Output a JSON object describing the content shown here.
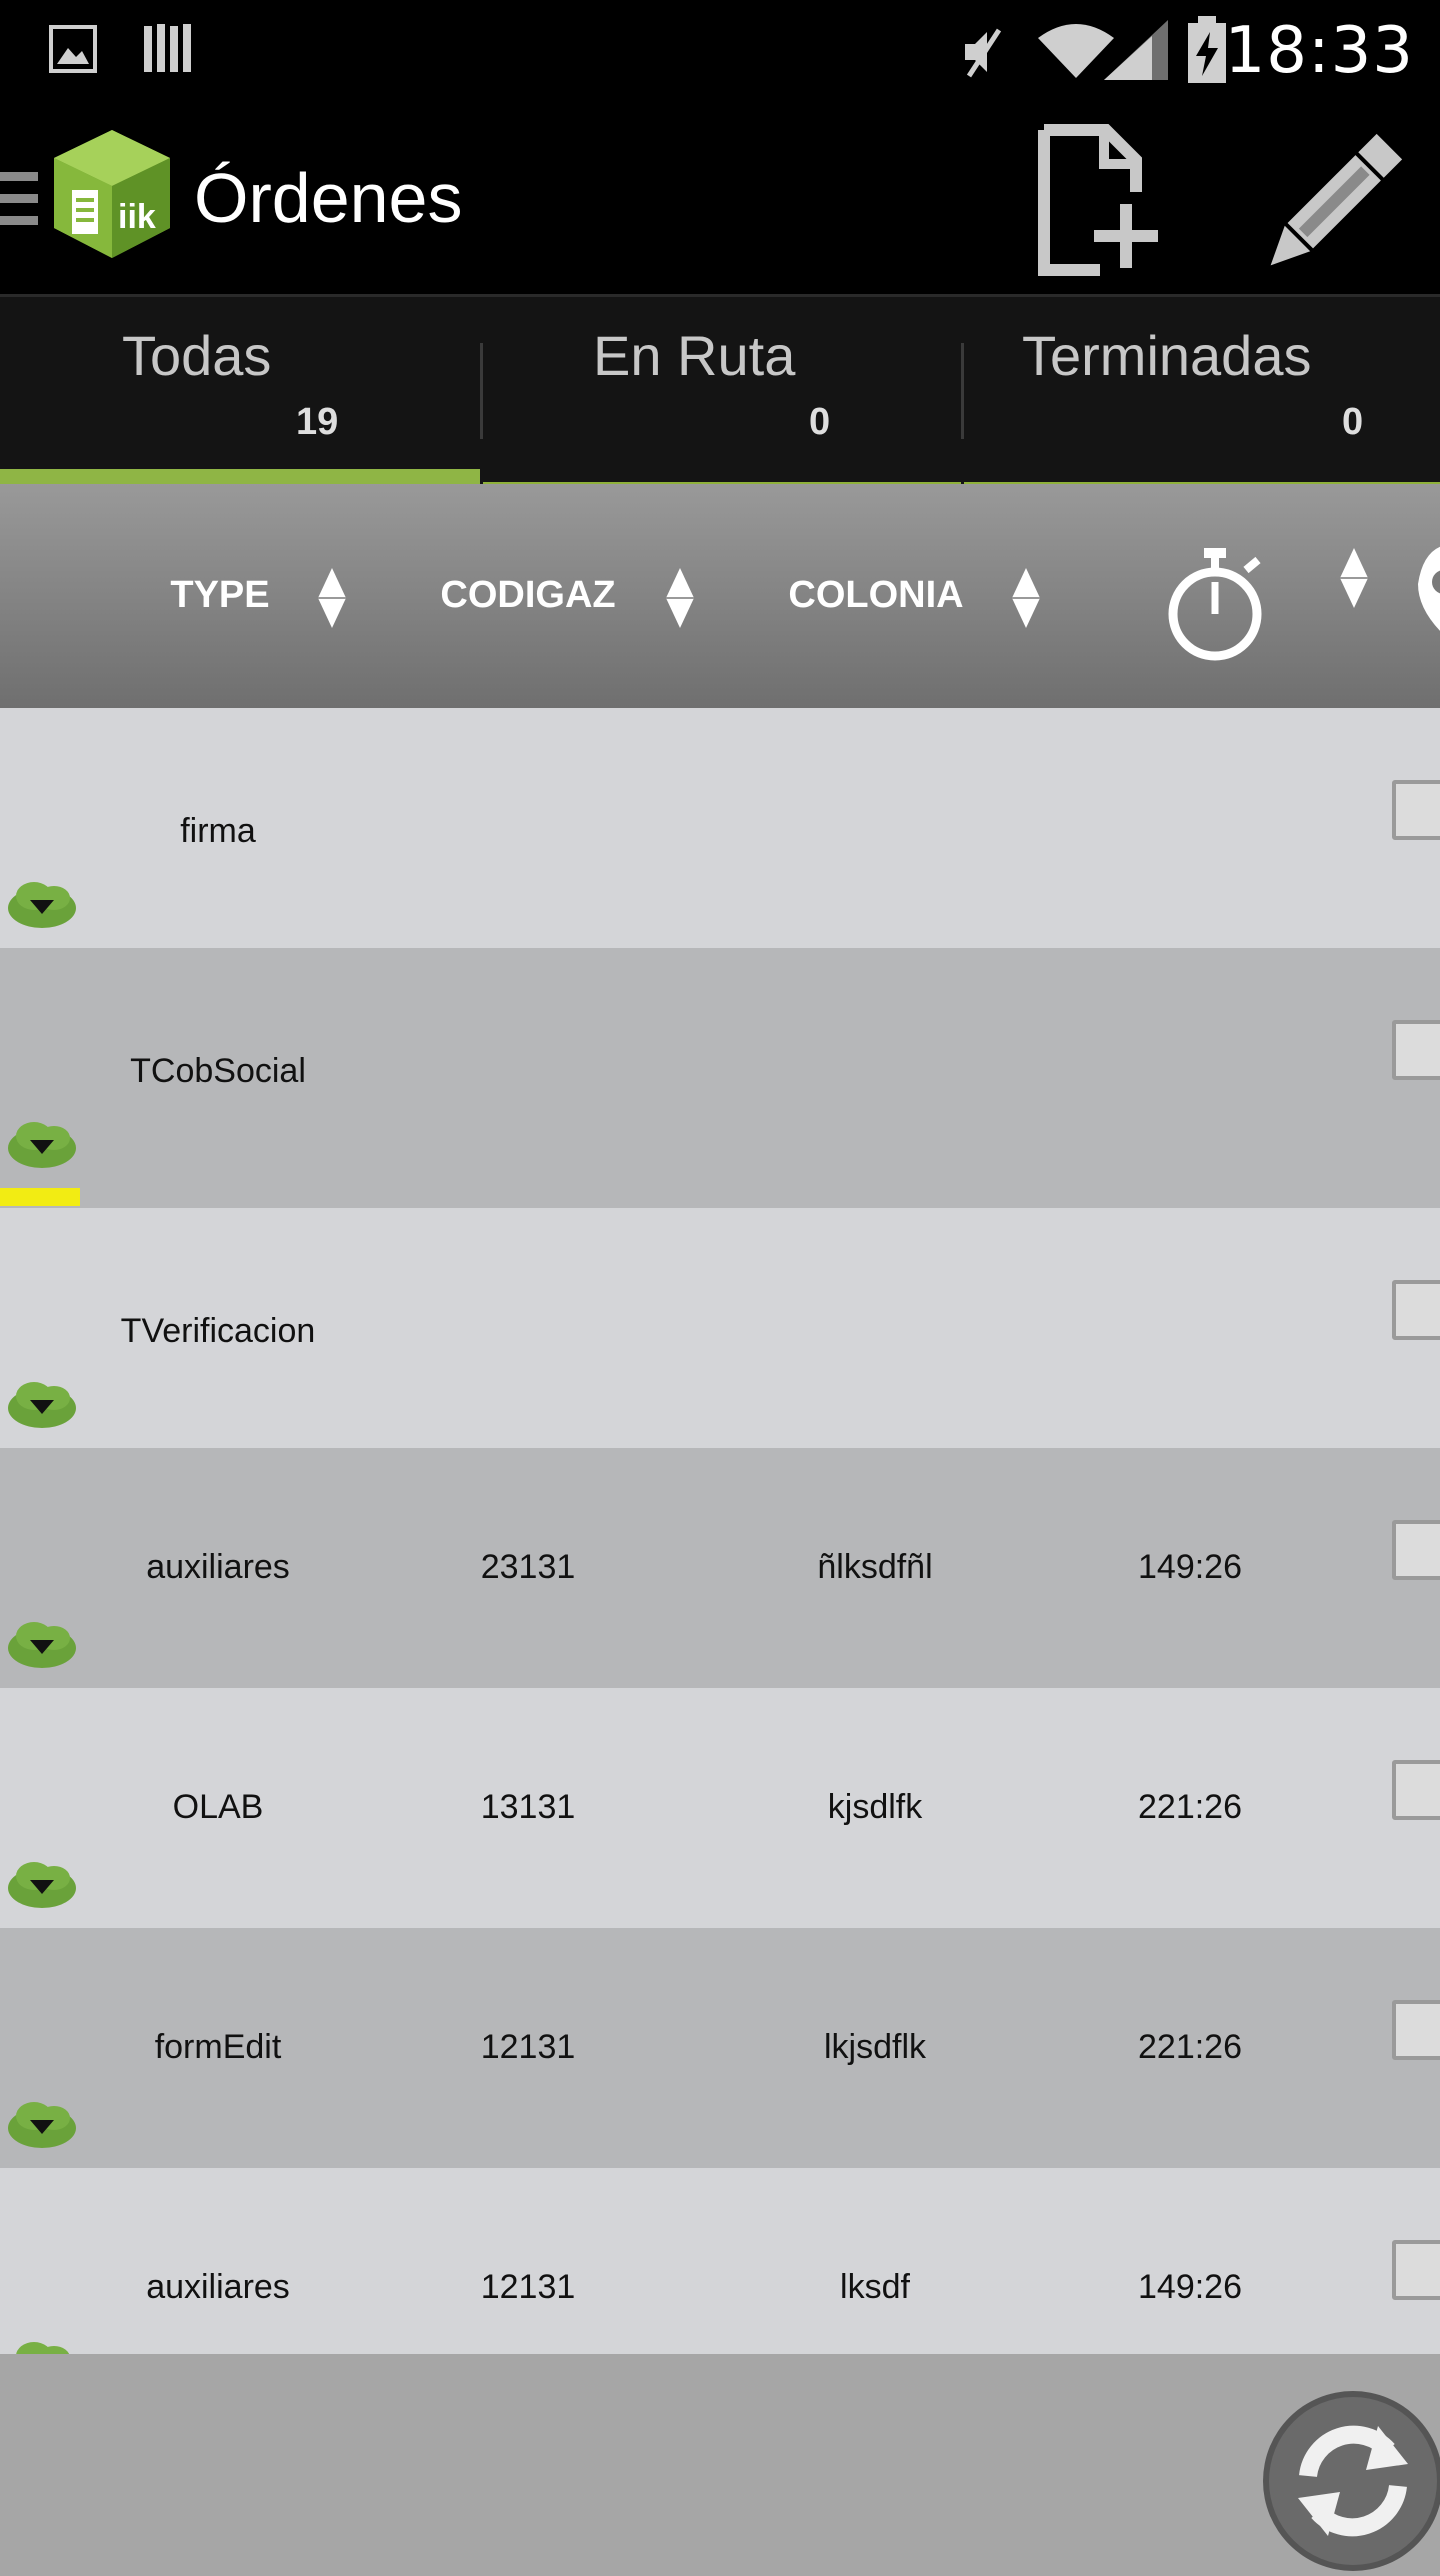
{
  "status_bar": {
    "time": "18:33",
    "icons": [
      "image-icon",
      "storage-icon",
      "mute-icon",
      "wifi-icon",
      "signal-icon",
      "battery-charging-icon"
    ]
  },
  "action_bar": {
    "title": "Órdenes",
    "logo_text": "iik",
    "actions": [
      "new-document-icon",
      "edit-pencil-icon"
    ]
  },
  "tabs": [
    {
      "label": "Todas",
      "count": "19"
    },
    {
      "label": "En Ruta",
      "count": "0"
    },
    {
      "label": "Terminadas",
      "count": "0"
    }
  ],
  "table": {
    "columns": [
      "TYPE",
      "CODIGAZ",
      "COLONIA"
    ],
    "column_icons": [
      "stopwatch-icon",
      "location-pin-icon"
    ],
    "rows": [
      {
        "type": "firma",
        "codigaz": "",
        "colonia": "",
        "time": ""
      },
      {
        "type": "TCobSocial",
        "codigaz": "",
        "colonia": "",
        "time": ""
      },
      {
        "type": "TVerificacion",
        "codigaz": "",
        "colonia": "",
        "time": ""
      },
      {
        "type": "auxiliares",
        "codigaz": "23131",
        "colonia": "ñlksdfñl",
        "time": "149:26"
      },
      {
        "type": "OLAB",
        "codigaz": "13131",
        "colonia": "kjsdlfk",
        "time": "221:26"
      },
      {
        "type": "formEdit",
        "codigaz": "12131",
        "colonia": "lkjsdflk",
        "time": "221:26"
      },
      {
        "type": "auxiliares",
        "codigaz": "12131",
        "colonia": "lksdf",
        "time": "149:26"
      }
    ]
  },
  "colors": {
    "accent_green": "#8fb545",
    "row_light": "#d4d5d8",
    "row_dark": "#b6b7b9",
    "marker_yellow": "#f2ec13"
  }
}
